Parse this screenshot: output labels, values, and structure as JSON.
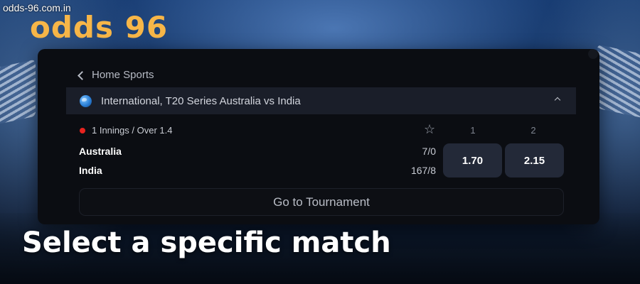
{
  "site": {
    "url": "odds-96.com.in",
    "logo": "odds 96",
    "logo_color": "#f7b648"
  },
  "nav": {
    "back_label": "Home Sports"
  },
  "league": {
    "title": "International, T20 Series Australia vs India",
    "icon": "globe-icon"
  },
  "match": {
    "status": "1 Innings / Over 1.4",
    "live_color": "#e8231f",
    "columns": [
      "1",
      "2"
    ],
    "teams": [
      {
        "name": "Australia",
        "score": "7/0"
      },
      {
        "name": "India",
        "score": "167/8"
      }
    ],
    "odds": [
      "1.70",
      "2.15"
    ]
  },
  "tournament_button": "Go to Tournament",
  "caption": "Select a specific match"
}
